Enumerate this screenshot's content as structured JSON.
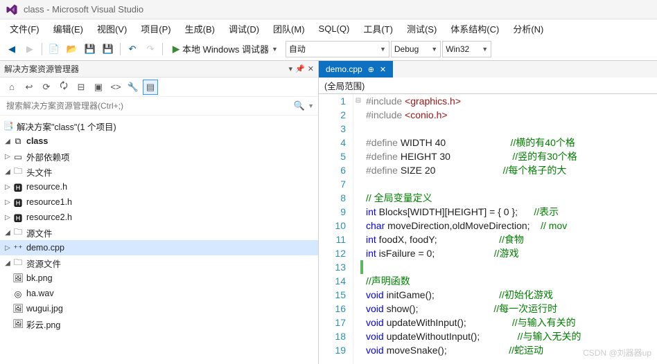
{
  "title": "class - Microsoft Visual Studio",
  "menu": [
    "文件(F)",
    "编辑(E)",
    "视图(V)",
    "项目(P)",
    "生成(B)",
    "调试(D)",
    "团队(M)",
    "SQL(Q)",
    "工具(T)",
    "测试(S)",
    "体系结构(C)",
    "分析(N)"
  ],
  "toolbar": {
    "debug_target": "本地 Windows 调试器",
    "combo1": "自动",
    "config": "Debug",
    "platform": "Win32"
  },
  "solution_panel": {
    "title": "解决方案资源管理器",
    "search_placeholder": "搜索解决方案资源管理器(Ctrl+;)",
    "root": "解决方案\"class\"(1 个项目)"
  },
  "tree": {
    "project": "class",
    "ext_deps": "外部依赖项",
    "headers": "头文件",
    "h1": "resource.h",
    "h2": "resource1.h",
    "h3": "resource2.h",
    "sources": "源文件",
    "s1": "demo.cpp",
    "resources": "资源文件",
    "r1": "bk.png",
    "r2": "ha.wav",
    "r3": "wugui.jpg",
    "r4": "彩云.png"
  },
  "tab": {
    "name": "demo.cpp"
  },
  "scope": "(全局范围)",
  "code": [
    {
      "n": 1,
      "t": "#include <graphics.h>",
      "cls": "inc"
    },
    {
      "n": 2,
      "t": "#include <conio.h>",
      "cls": "inc"
    },
    {
      "n": 3,
      "t": "",
      "cls": ""
    },
    {
      "n": 4,
      "t": "#define WIDTH 40",
      "c": "//横的有40个格",
      "cls": "def"
    },
    {
      "n": 5,
      "t": "#define HEIGHT 30",
      "c": "//竖的有30个格",
      "cls": "def"
    },
    {
      "n": 6,
      "t": "#define SIZE 20",
      "c": "//每个格子的大",
      "cls": "def"
    },
    {
      "n": 7,
      "t": "",
      "cls": ""
    },
    {
      "n": 8,
      "t": "// 全局变量定义",
      "cls": "cmt"
    },
    {
      "n": 9,
      "t": "int Blocks[WIDTH][HEIGHT] = { 0 };",
      "c": "//表示",
      "cls": "stmt"
    },
    {
      "n": 10,
      "t": "char moveDirection,oldMoveDirection;",
      "c": "// mov",
      "cls": "stmt"
    },
    {
      "n": 11,
      "t": "int foodX, foodY;",
      "c": "//食物",
      "cls": "stmt"
    },
    {
      "n": 12,
      "t": "int isFailure = 0;",
      "c": "//游戏",
      "cls": "stmt"
    },
    {
      "n": 13,
      "t": "",
      "cls": ""
    },
    {
      "n": 14,
      "t": "//声明函数",
      "cls": "cmt"
    },
    {
      "n": 15,
      "t": "void initGame();",
      "c": "//初始化游戏",
      "cls": "stmt"
    },
    {
      "n": 16,
      "t": "void show();",
      "c": "//每一次运行时",
      "cls": "stmt"
    },
    {
      "n": 17,
      "t": "void updateWithInput();",
      "c": "//与输入有关的",
      "cls": "stmt"
    },
    {
      "n": 18,
      "t": "void updateWithoutInput();",
      "c": "//与输入无关的",
      "cls": "stmt"
    },
    {
      "n": 19,
      "t": "void moveSnake();",
      "c": "//蛇运动",
      "cls": "stmt"
    }
  ],
  "watermark": "CSDN @刘器器up"
}
